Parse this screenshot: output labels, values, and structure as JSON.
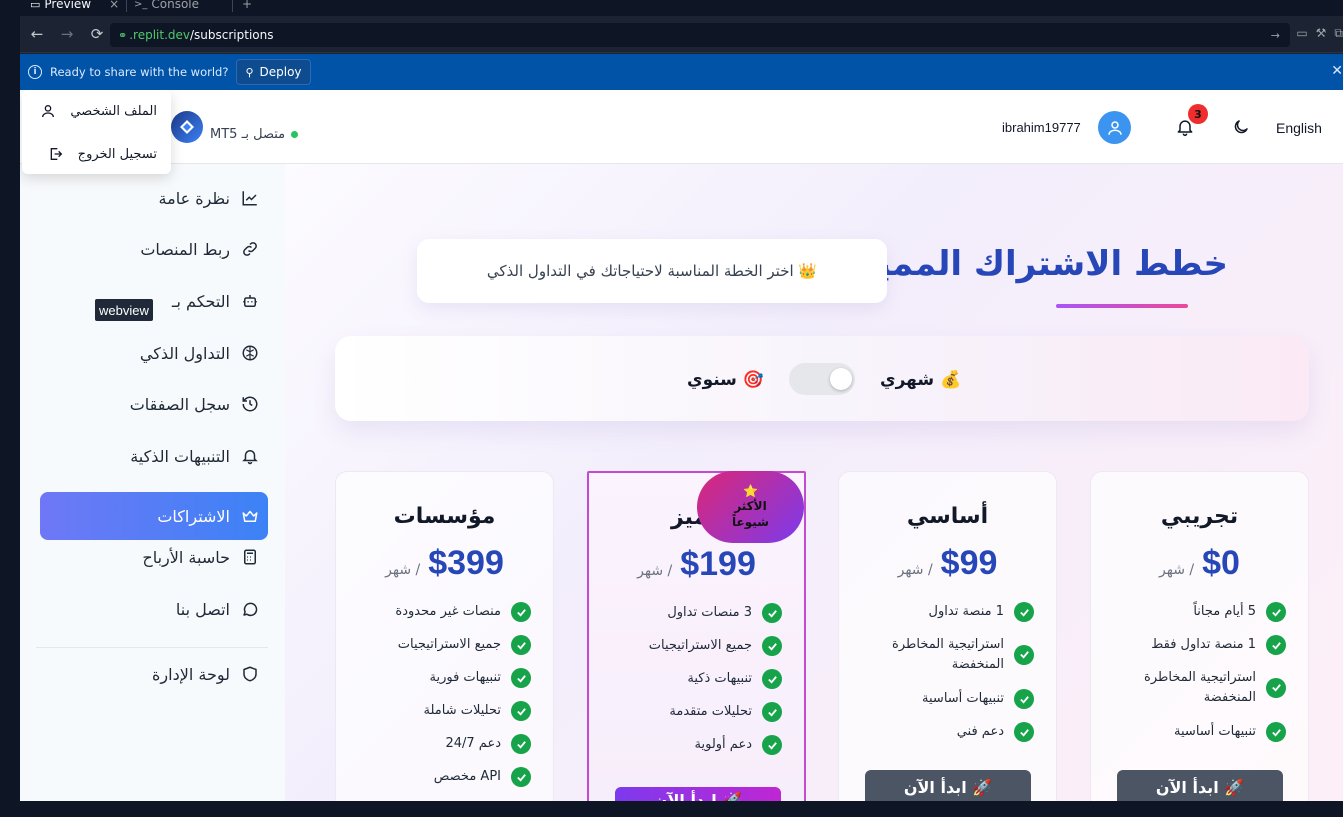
{
  "chrome": {
    "tabs": [
      {
        "label": "Preview"
      },
      {
        "label": "Console"
      }
    ],
    "url_host": ".replit.dev",
    "url_path": "/subscriptions",
    "deploy_prompt": "Ready to share with the world?",
    "deploy_label": "Deploy"
  },
  "topbar": {
    "language": "English",
    "notification_count": "3",
    "username": "ibrahim19777",
    "mt5_status": "متصل بـ MT5"
  },
  "user_menu": {
    "profile": "الملف الشخصي",
    "logout": "تسجيل الخروج"
  },
  "sidebar": {
    "tooltip": "webview",
    "items": [
      {
        "label": "نظرة عامة",
        "icon": "chart-line-icon"
      },
      {
        "label": "ربط المنصات",
        "icon": "link-icon"
      },
      {
        "label": "التحكم بـ",
        "icon": "bot-icon"
      },
      {
        "label": "التداول الذكي",
        "icon": "brain-icon"
      },
      {
        "label": "سجل الصفقات",
        "icon": "history-icon"
      },
      {
        "label": "التنبيهات الذكية",
        "icon": "bell-icon"
      },
      {
        "label": "الاشتراكات",
        "icon": "crown-icon"
      },
      {
        "label": "حاسبة الأرباح",
        "icon": "calculator-icon"
      },
      {
        "label": "اتصل بنا",
        "icon": "message-icon"
      },
      {
        "label": "لوحة الإدارة",
        "icon": "shield-icon"
      }
    ]
  },
  "main": {
    "title": "خطط الاشتراك المميزة",
    "subtitle": "👑 اختر الخطة المناسبة لاحتياجاتك في التداول الذكي",
    "billing": {
      "monthly": "💰 شهري",
      "yearly": "🎯 سنوي"
    },
    "per_month": "/ شهر",
    "cta": "🚀 ابدأ الآن",
    "popular_badge": "⭐",
    "popular_text_1": "الأكثر",
    "popular_text_2": "شيوعاً",
    "plans": [
      {
        "name": "تجريبي",
        "price": "$0",
        "features": [
          "5 أيام مجاناً",
          "1 منصة تداول فقط",
          "استراتيجية المخاطرة المنخفضة",
          "تنبيهات أساسية"
        ]
      },
      {
        "name": "أساسي",
        "price": "$99",
        "features": [
          "1 منصة تداول",
          "استراتيجية المخاطرة المنخفضة",
          "تنبيهات أساسية",
          "دعم فني"
        ]
      },
      {
        "name": "مميز",
        "price": "$199",
        "features": [
          "3 منصات تداول",
          "جميع الاستراتيجيات",
          "تنبيهات ذكية",
          "تحليلات متقدمة",
          "دعم أولوية"
        ]
      },
      {
        "name": "مؤسسات",
        "price": "$399",
        "features": [
          "منصات غير محدودة",
          "جميع الاستراتيجيات",
          "تنبيهات فورية",
          "تحليلات شاملة",
          "دعم 24/7",
          "API مخصص"
        ]
      }
    ]
  },
  "colors": {
    "accent_blue": "#2747b8",
    "active_nav": "#5b7cf7",
    "check_green": "#16a34a",
    "featured_border": "#c24bd1"
  }
}
